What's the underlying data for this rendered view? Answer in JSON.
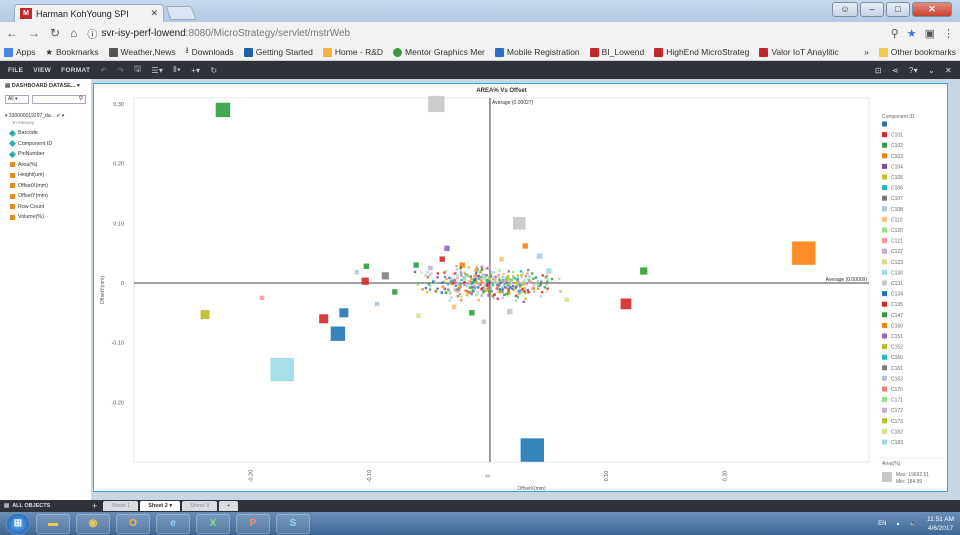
{
  "browser": {
    "tab_title": "Harman KohYoung SPI",
    "url_host": "svr-isy-perf-lowend",
    "url_path": ":8080/MicroStrategy/servlet/mstrWeb"
  },
  "bookmarks": {
    "items": [
      "Apps",
      "Bookmarks",
      "Weather,News",
      "Downloads",
      "Getting Started",
      "Home - R&D",
      "Mentor Graphics Mer",
      "Mobile Registration",
      "BI_Lowend",
      "HighEnd MicroStrateg",
      "Valor IoT Anaylitic"
    ],
    "other": "Other bookmarks"
  },
  "mstr_toolbar": {
    "file": "FILE",
    "view": "VIEW",
    "format": "FORMAT"
  },
  "dataset_panel": {
    "header": "DASHBOARD DATASE...",
    "filter": "All",
    "dataset_name": "330000019297_da...",
    "in_memory": "In memory",
    "objects": [
      {
        "name": "Barcode",
        "kind": "attribute"
      },
      {
        "name": "Component ID",
        "kind": "attribute"
      },
      {
        "name": "PinNumber",
        "kind": "attribute"
      },
      {
        "name": "Area(%)",
        "kind": "metric"
      },
      {
        "name": "Height(um)",
        "kind": "metric"
      },
      {
        "name": "OffsetX(mm)",
        "kind": "metric"
      },
      {
        "name": "OffsetY(mm)",
        "kind": "metric"
      },
      {
        "name": "Row Count",
        "kind": "metric"
      },
      {
        "name": "Volume(%)",
        "kind": "metric"
      }
    ]
  },
  "chart_data": {
    "type": "scatter",
    "title": "AREA% Vs Offset",
    "xlabel": "OffsetX(mm)",
    "ylabel": "OffsetY(mm)",
    "xlim": [
      -0.3,
      0.32
    ],
    "ylim": [
      -0.3,
      0.31
    ],
    "x_ticks": [
      -0.2,
      -0.1,
      0,
      0.1,
      0.2
    ],
    "y_ticks": [
      0.3,
      0.2,
      0.1,
      0,
      -0.1,
      -0.2
    ],
    "x_tick_labels": [
      "-0.20",
      "-0.10",
      "0",
      "0.10",
      "0.20"
    ],
    "y_tick_labels": [
      "0.30",
      "0.20",
      "0.10",
      "0",
      "-0.10",
      "-0.20"
    ],
    "reference_lines": {
      "vertical": {
        "x": 0.00027,
        "label": "Average (0.00027)"
      },
      "horizontal": {
        "y": 0.0,
        "label": "Average (0.00009)"
      }
    },
    "grid": false,
    "legend_placement": "right",
    "legend_title": "Component ID",
    "legend": [
      {
        "name": "",
        "color": "#2a74b5"
      },
      {
        "name": "C101",
        "color": "#d8262d"
      },
      {
        "name": "C102",
        "color": "#2f9e44"
      },
      {
        "name": "C103",
        "color": "#ee7d1a"
      },
      {
        "name": "C104",
        "color": "#7e4fa1"
      },
      {
        "name": "C105",
        "color": "#c2c225"
      },
      {
        "name": "C106",
        "color": "#21b4c4"
      },
      {
        "name": "C107",
        "color": "#777777"
      },
      {
        "name": "C108",
        "color": "#aec7e8"
      },
      {
        "name": "C110",
        "color": "#ffbb78"
      },
      {
        "name": "C120",
        "color": "#98df8a"
      },
      {
        "name": "C121",
        "color": "#ff9896"
      },
      {
        "name": "C122",
        "color": "#c5b0d5"
      },
      {
        "name": "C123",
        "color": "#dbdb8d"
      },
      {
        "name": "C130",
        "color": "#9edae5"
      },
      {
        "name": "C131",
        "color": "#c7c7c7"
      },
      {
        "name": "C134",
        "color": "#1f77b4"
      },
      {
        "name": "C135",
        "color": "#d62728"
      },
      {
        "name": "C147",
        "color": "#2ca02c"
      },
      {
        "name": "C150",
        "color": "#ff7f0e"
      },
      {
        "name": "C151",
        "color": "#9467bd"
      },
      {
        "name": "C152",
        "color": "#bcbd22"
      },
      {
        "name": "C160",
        "color": "#17becf"
      },
      {
        "name": "C161",
        "color": "#7f7f7f"
      },
      {
        "name": "C163",
        "color": "#aec7e8"
      },
      {
        "name": "C170",
        "color": "#f08080"
      },
      {
        "name": "C171",
        "color": "#98df8a"
      },
      {
        "name": "C172",
        "color": "#c5b0d5"
      },
      {
        "name": "C173",
        "color": "#bcbd22"
      },
      {
        "name": "C182",
        "color": "#dbdb8d"
      },
      {
        "name": "C183",
        "color": "#9edae5"
      }
    ],
    "size_legend": {
      "title": "Area(%)",
      "max_label": "Max: 19692.51",
      "min_label": "Min: 184.99"
    },
    "points": [
      {
        "x": -0.225,
        "y": 0.29,
        "size": 8,
        "color": "#2f9e44"
      },
      {
        "x": -0.045,
        "y": 0.3,
        "size": 9,
        "color": "#c7c7c7"
      },
      {
        "x": 0.025,
        "y": 0.1,
        "size": 7,
        "color": "#c7c7c7"
      },
      {
        "x": 0.265,
        "y": 0.05,
        "size": 13,
        "color": "#ff7f0e"
      },
      {
        "x": -0.24,
        "y": -0.053,
        "size": 5,
        "color": "#bcbd22"
      },
      {
        "x": -0.175,
        "y": -0.145,
        "size": 13,
        "color": "#9edae5"
      },
      {
        "x": -0.128,
        "y": -0.085,
        "size": 8,
        "color": "#1f77b4"
      },
      {
        "x": -0.14,
        "y": -0.06,
        "size": 5,
        "color": "#d62728"
      },
      {
        "x": -0.123,
        "y": -0.05,
        "size": 5,
        "color": "#1f77b4"
      },
      {
        "x": 0.036,
        "y": -0.28,
        "size": 13,
        "color": "#1f77b4"
      },
      {
        "x": 0.115,
        "y": -0.035,
        "size": 6,
        "color": "#d62728"
      },
      {
        "x": 0.13,
        "y": 0.02,
        "size": 4,
        "color": "#2ca02c"
      },
      {
        "x": -0.105,
        "y": 0.003,
        "size": 4,
        "color": "#d62728"
      },
      {
        "x": -0.088,
        "y": 0.012,
        "size": 4,
        "color": "#7f7f7f"
      },
      {
        "x": -0.104,
        "y": 0.028,
        "size": 3,
        "color": "#2ca02c"
      },
      {
        "x": -0.036,
        "y": 0.058,
        "size": 3,
        "color": "#9467bd"
      },
      {
        "x": -0.04,
        "y": 0.04,
        "size": 3,
        "color": "#d62728"
      },
      {
        "x": -0.062,
        "y": 0.03,
        "size": 3,
        "color": "#2f9e44"
      },
      {
        "x": -0.08,
        "y": -0.015,
        "size": 3,
        "color": "#2f9e44"
      },
      {
        "x": -0.023,
        "y": 0.03,
        "size": 3,
        "color": "#ff7f0e"
      },
      {
        "x": 0.03,
        "y": 0.062,
        "size": 3,
        "color": "#ff7f0e"
      },
      {
        "x": 0.042,
        "y": 0.045,
        "size": 3,
        "color": "#aec7e8"
      },
      {
        "x": -0.015,
        "y": -0.05,
        "size": 3,
        "color": "#2ca02c"
      },
      {
        "x": 0.017,
        "y": -0.048,
        "size": 3,
        "color": "#c7c7c7"
      },
      {
        "x": -0.06,
        "y": -0.055,
        "size": 2.5,
        "color": "#dbdb8d"
      },
      {
        "x": -0.192,
        "y": -0.025,
        "size": 2.5,
        "color": "#ff9896"
      },
      {
        "x": -0.095,
        "y": -0.035,
        "size": 2.5,
        "color": "#aec7e8"
      },
      {
        "x": 0.065,
        "y": -0.028,
        "size": 2.5,
        "color": "#dbdb8d"
      },
      {
        "x": 0.05,
        "y": 0.02,
        "size": 3,
        "color": "#9edae5"
      },
      {
        "x": -0.05,
        "y": 0.025,
        "size": 2.5,
        "color": "#c5b0d5"
      },
      {
        "x": -0.03,
        "y": -0.04,
        "size": 2.5,
        "color": "#ffbb78"
      },
      {
        "x": 0.01,
        "y": 0.04,
        "size": 2.5,
        "color": "#ffbb78"
      },
      {
        "x": -0.112,
        "y": 0.018,
        "size": 2.5,
        "color": "#aec7e8"
      },
      {
        "x": -0.005,
        "y": -0.065,
        "size": 2.5,
        "color": "#c7c7c7"
      }
    ]
  },
  "sheets": {
    "all_objects": "ALL OBJECTS",
    "tabs": [
      "Sheet 1",
      "Sheet 2",
      "Sheet 3"
    ],
    "active_index": 1
  },
  "taskbar": {
    "lang": "EN",
    "time": "11:51 AM",
    "date": "4/6/2017"
  },
  "colors": {
    "chart_border": "#3ca1d6",
    "toolbar_bg": "#2f3339",
    "reference_line": "#000000"
  }
}
